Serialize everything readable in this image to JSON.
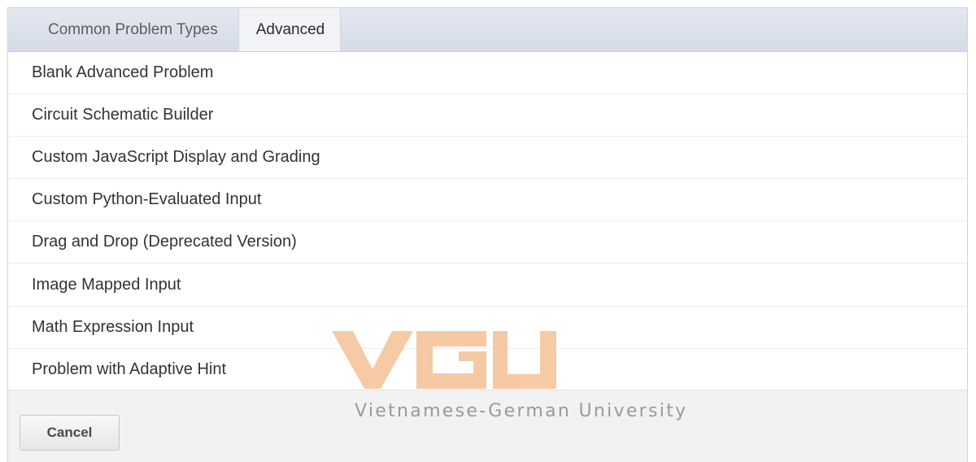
{
  "tabs": [
    {
      "label": "Common Problem Types"
    },
    {
      "label": "Advanced"
    }
  ],
  "active_tab": "Advanced",
  "problem_types": [
    {
      "label": "Blank Advanced Problem"
    },
    {
      "label": "Circuit Schematic Builder"
    },
    {
      "label": "Custom JavaScript Display and Grading"
    },
    {
      "label": "Custom Python-Evaluated Input"
    },
    {
      "label": "Drag and Drop (Deprecated Version)"
    },
    {
      "label": "Image Mapped Input"
    },
    {
      "label": "Math Expression Input"
    },
    {
      "label": "Problem with Adaptive Hint"
    }
  ],
  "footer": {
    "cancel_label": "Cancel"
  },
  "watermark": {
    "logo_text": "VGU",
    "subtitle": "Vietnamese-German University",
    "color": "#f5c49b"
  },
  "colors": {
    "tab_bar": "#dde3ec",
    "footer": "#f2f2f2"
  }
}
